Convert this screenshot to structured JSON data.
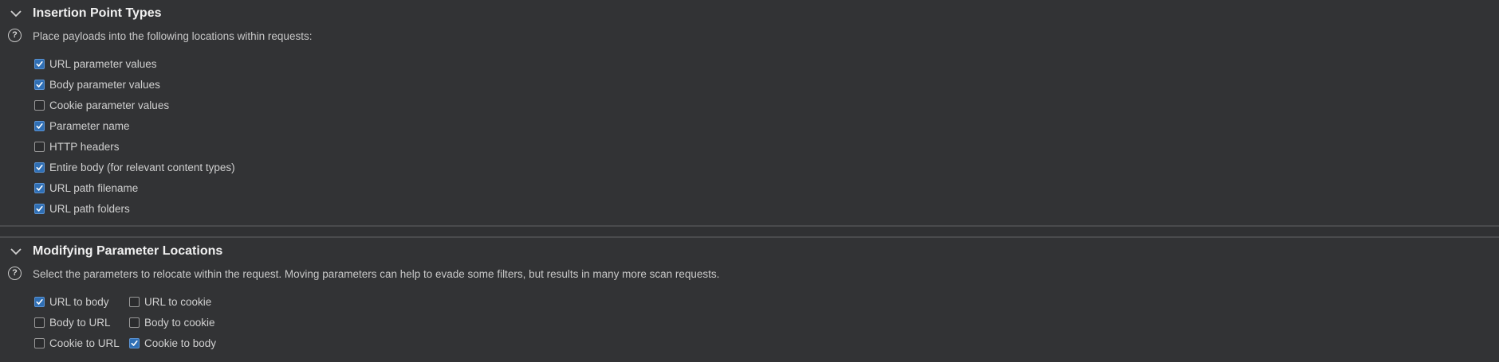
{
  "insertion_point_types": {
    "title": "Insertion Point Types",
    "description": "Place payloads into the following locations within requests:",
    "options": [
      {
        "label": "URL parameter values",
        "checked": true
      },
      {
        "label": "Body parameter values",
        "checked": true
      },
      {
        "label": "Cookie parameter values",
        "checked": false
      },
      {
        "label": "Parameter name",
        "checked": true
      },
      {
        "label": "HTTP headers",
        "checked": false
      },
      {
        "label": "Entire body (for relevant content types)",
        "checked": true
      },
      {
        "label": "URL path filename",
        "checked": true
      },
      {
        "label": "URL path folders",
        "checked": true
      }
    ]
  },
  "modifying_parameter_locations": {
    "title": "Modifying Parameter Locations",
    "description": "Select the parameters to relocate within the request. Moving parameters can help to evade some filters, but results in many more scan requests.",
    "options": [
      {
        "label": "URL to body",
        "checked": true
      },
      {
        "label": "URL to cookie",
        "checked": false
      },
      {
        "label": "Body to URL",
        "checked": false
      },
      {
        "label": "Body to cookie",
        "checked": false
      },
      {
        "label": "Cookie to URL",
        "checked": false
      },
      {
        "label": "Cookie to body",
        "checked": true
      }
    ]
  }
}
